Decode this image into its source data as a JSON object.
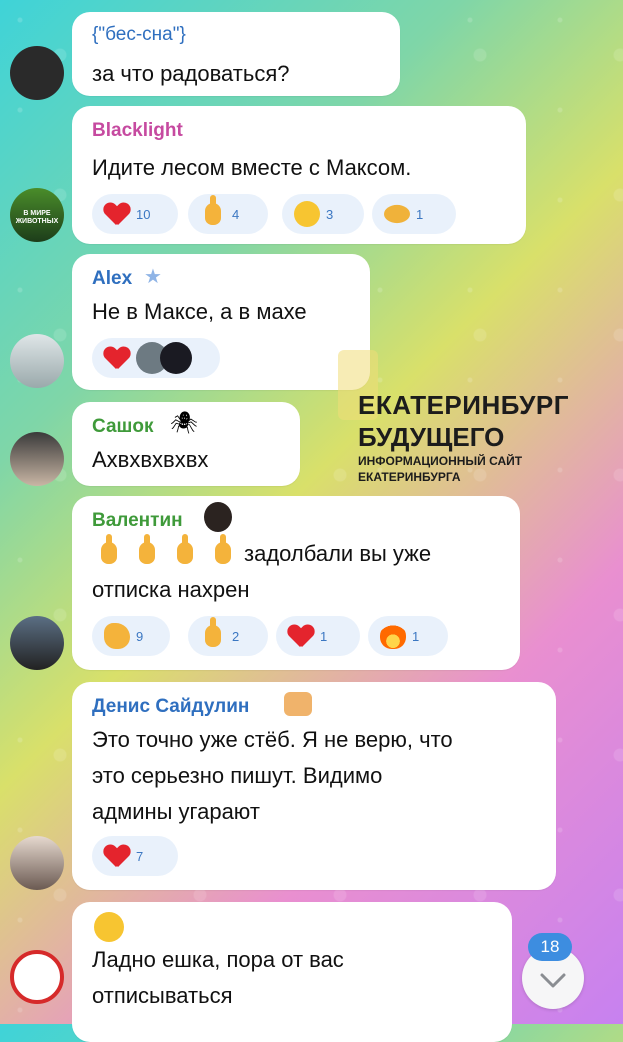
{
  "messages": [
    {
      "name": "{\"бес-сна\"}",
      "text": [
        "за что радоваться?"
      ],
      "name_color": "#3b77c2"
    },
    {
      "name": "Blacklight",
      "text": [
        "Идите лесом вместе с Максом."
      ],
      "name_color": "#c64aa0",
      "avatar_caption": "В МИРЕ ЖИВОТНЫХ",
      "reactions": [
        {
          "icon": "heart",
          "count": "10"
        },
        {
          "icon": "middle-finger",
          "count": "4"
        },
        {
          "icon": "laughing-face",
          "count": "3"
        },
        {
          "icon": "handshake",
          "count": "1"
        }
      ]
    },
    {
      "name": "Alex",
      "text": [
        "Не в Максе, а в махе"
      ],
      "name_color": "#3b77c2",
      "reactions": [
        {
          "icon": "heart",
          "count": ""
        }
      ]
    },
    {
      "name": "Сашок",
      "text": [
        "Ахвхвхвхвх"
      ],
      "name_color": "#3f9a3a"
    },
    {
      "name": "Валентин",
      "text": [
        "задолбали вы уже",
        "отписка нахрен"
      ],
      "name_color": "#3f9a3a",
      "reactions": [
        {
          "icon": "clapping",
          "count": "9"
        },
        {
          "icon": "middle-finger",
          "count": "2"
        },
        {
          "icon": "heart",
          "count": "1"
        },
        {
          "icon": "fire",
          "count": "1"
        }
      ]
    },
    {
      "name": "Денис Сайдулин",
      "text": [
        "Это точно уже стёб. Я не верю, что",
        "это серьезно пишут. Видимо",
        "админы угарают"
      ],
      "name_color": "#3b77c2",
      "reactions": [
        {
          "icon": "heart",
          "count": "7"
        }
      ]
    },
    {
      "name": "",
      "text": [
        "Ладно ешка, пора от вас",
        "отписываться"
      ]
    }
  ],
  "watermark": {
    "line1": "ЕКАТЕРИНБУРГ",
    "line2": "БУДУЩЕГО",
    "line3": "ИНФОРМАЦИОННЫЙ САЙТ",
    "line4": "ЕКАТЕРИНБУРГА"
  },
  "unread_count": "18",
  "colors": {
    "heart": "#e4242d",
    "reaction_bg": "#e9f1fb",
    "badge": "#3d8de0"
  }
}
